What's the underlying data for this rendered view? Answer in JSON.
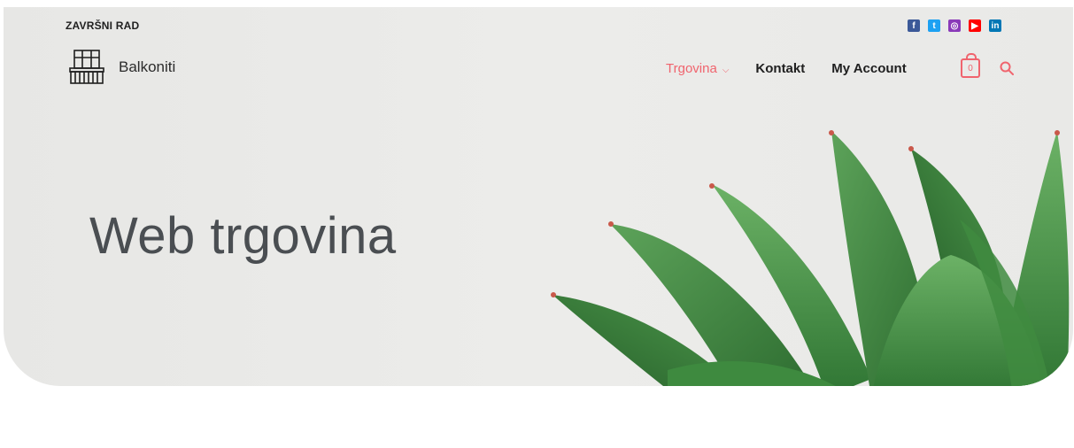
{
  "topbar": {
    "site_title": "ZAVRŠNI RAD",
    "social": [
      {
        "icon": "facebook-icon",
        "glyph": "f",
        "color": "#3b5998"
      },
      {
        "icon": "twitter-icon",
        "glyph": "t",
        "color": "#1da1f2"
      },
      {
        "icon": "instagram-icon",
        "glyph": "◎",
        "color": "#8a3ab9"
      },
      {
        "icon": "youtube-icon",
        "glyph": "▶",
        "color": "#ff0000"
      },
      {
        "icon": "linkedin-icon",
        "glyph": "in",
        "color": "#0077b5"
      }
    ]
  },
  "header": {
    "logo_text": "Balkoniti",
    "nav": [
      {
        "label": "Trgovina",
        "active": true
      },
      {
        "label": "Kontakt"
      },
      {
        "label": "My Account"
      }
    ],
    "cart_count": "0"
  },
  "hero": {
    "title": "Web trgovina"
  },
  "colors": {
    "accent": "#f0646e",
    "hero_bg": "#e9e9e7",
    "heading": "#4a4e52"
  }
}
